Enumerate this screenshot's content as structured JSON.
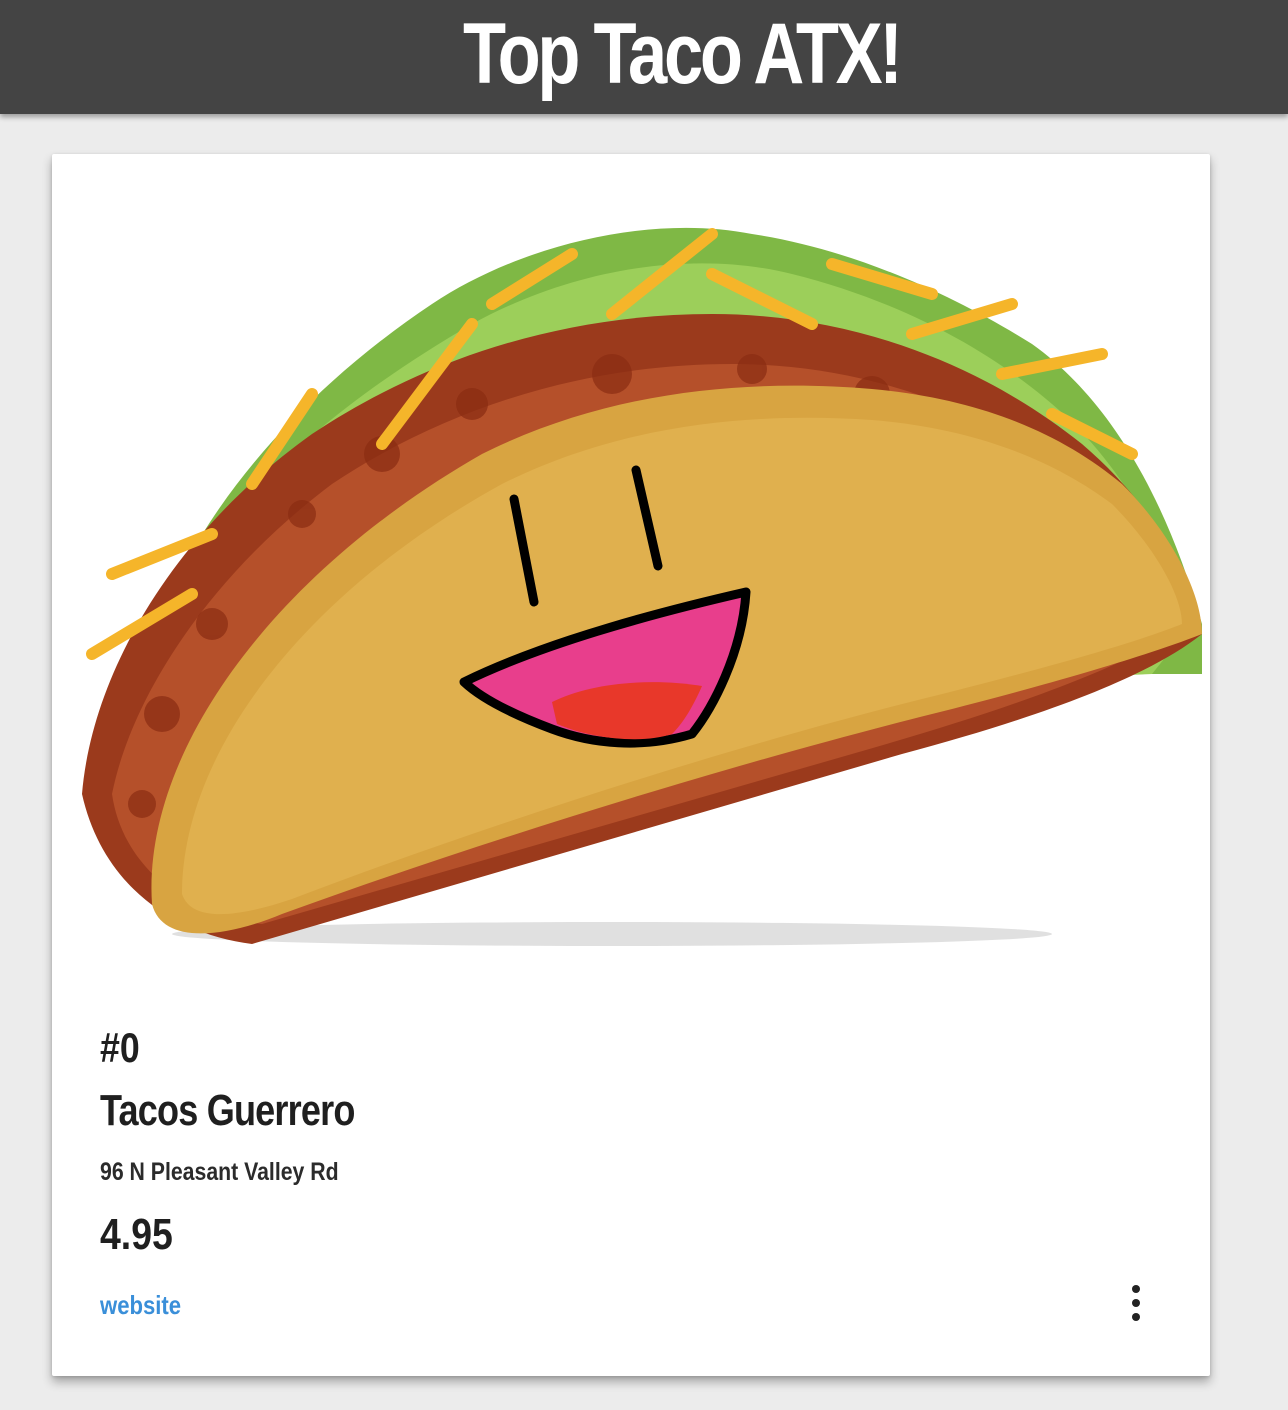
{
  "header": {
    "title": "Top Taco ATX!",
    "background_color": "#444444"
  },
  "card": {
    "image": {
      "icon": "taco-smiling-illustration"
    },
    "rank": "#0",
    "name": "Tacos Guerrero",
    "address": "96 N Pleasant Valley Rd",
    "rating": "4.95",
    "website_label": "website",
    "website_color": "#3a8fd9",
    "more_icon": "more-vertical-icon"
  }
}
